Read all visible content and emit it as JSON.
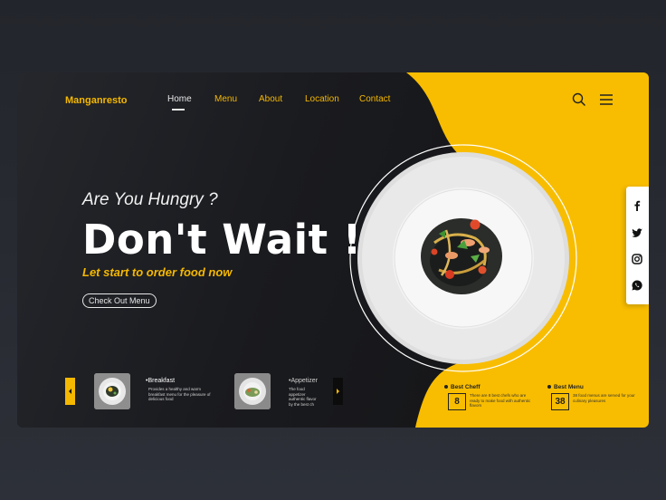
{
  "brand": "Manganresto",
  "nav": [
    {
      "label": "Home",
      "active": true
    },
    {
      "label": "Menu",
      "active": false
    },
    {
      "label": "About",
      "active": false
    },
    {
      "label": "Location",
      "active": false
    },
    {
      "label": "Contact",
      "active": false
    }
  ],
  "hero": {
    "eyebrow": "Are You Hungry ?",
    "headline": "Don't Wait !",
    "tagline": "Let start to order food now",
    "cta": "Check Out Menu"
  },
  "dishes": [
    {
      "title": "•Breakfast",
      "desc": "Provides a healthy and warm breakfast menu for the pleasure of delicious food"
    },
    {
      "title": "•Appetizer",
      "desc": "The food appetizer authentic flavor by the best ch"
    }
  ],
  "stats": [
    {
      "label": "Best Cheff",
      "value": "8",
      "desc": "There are 8 best chefs who are ready to make food with authentic flavors"
    },
    {
      "label": "Best Menu",
      "value": "38",
      "desc": "38 food menus are served for your culinary pleasures"
    }
  ],
  "social": [
    "facebook-icon",
    "twitter-icon",
    "instagram-icon",
    "whatsapp-icon"
  ],
  "colors": {
    "accent": "#f5b800",
    "dark": "#1a1b1f",
    "light": "#ffffff"
  }
}
